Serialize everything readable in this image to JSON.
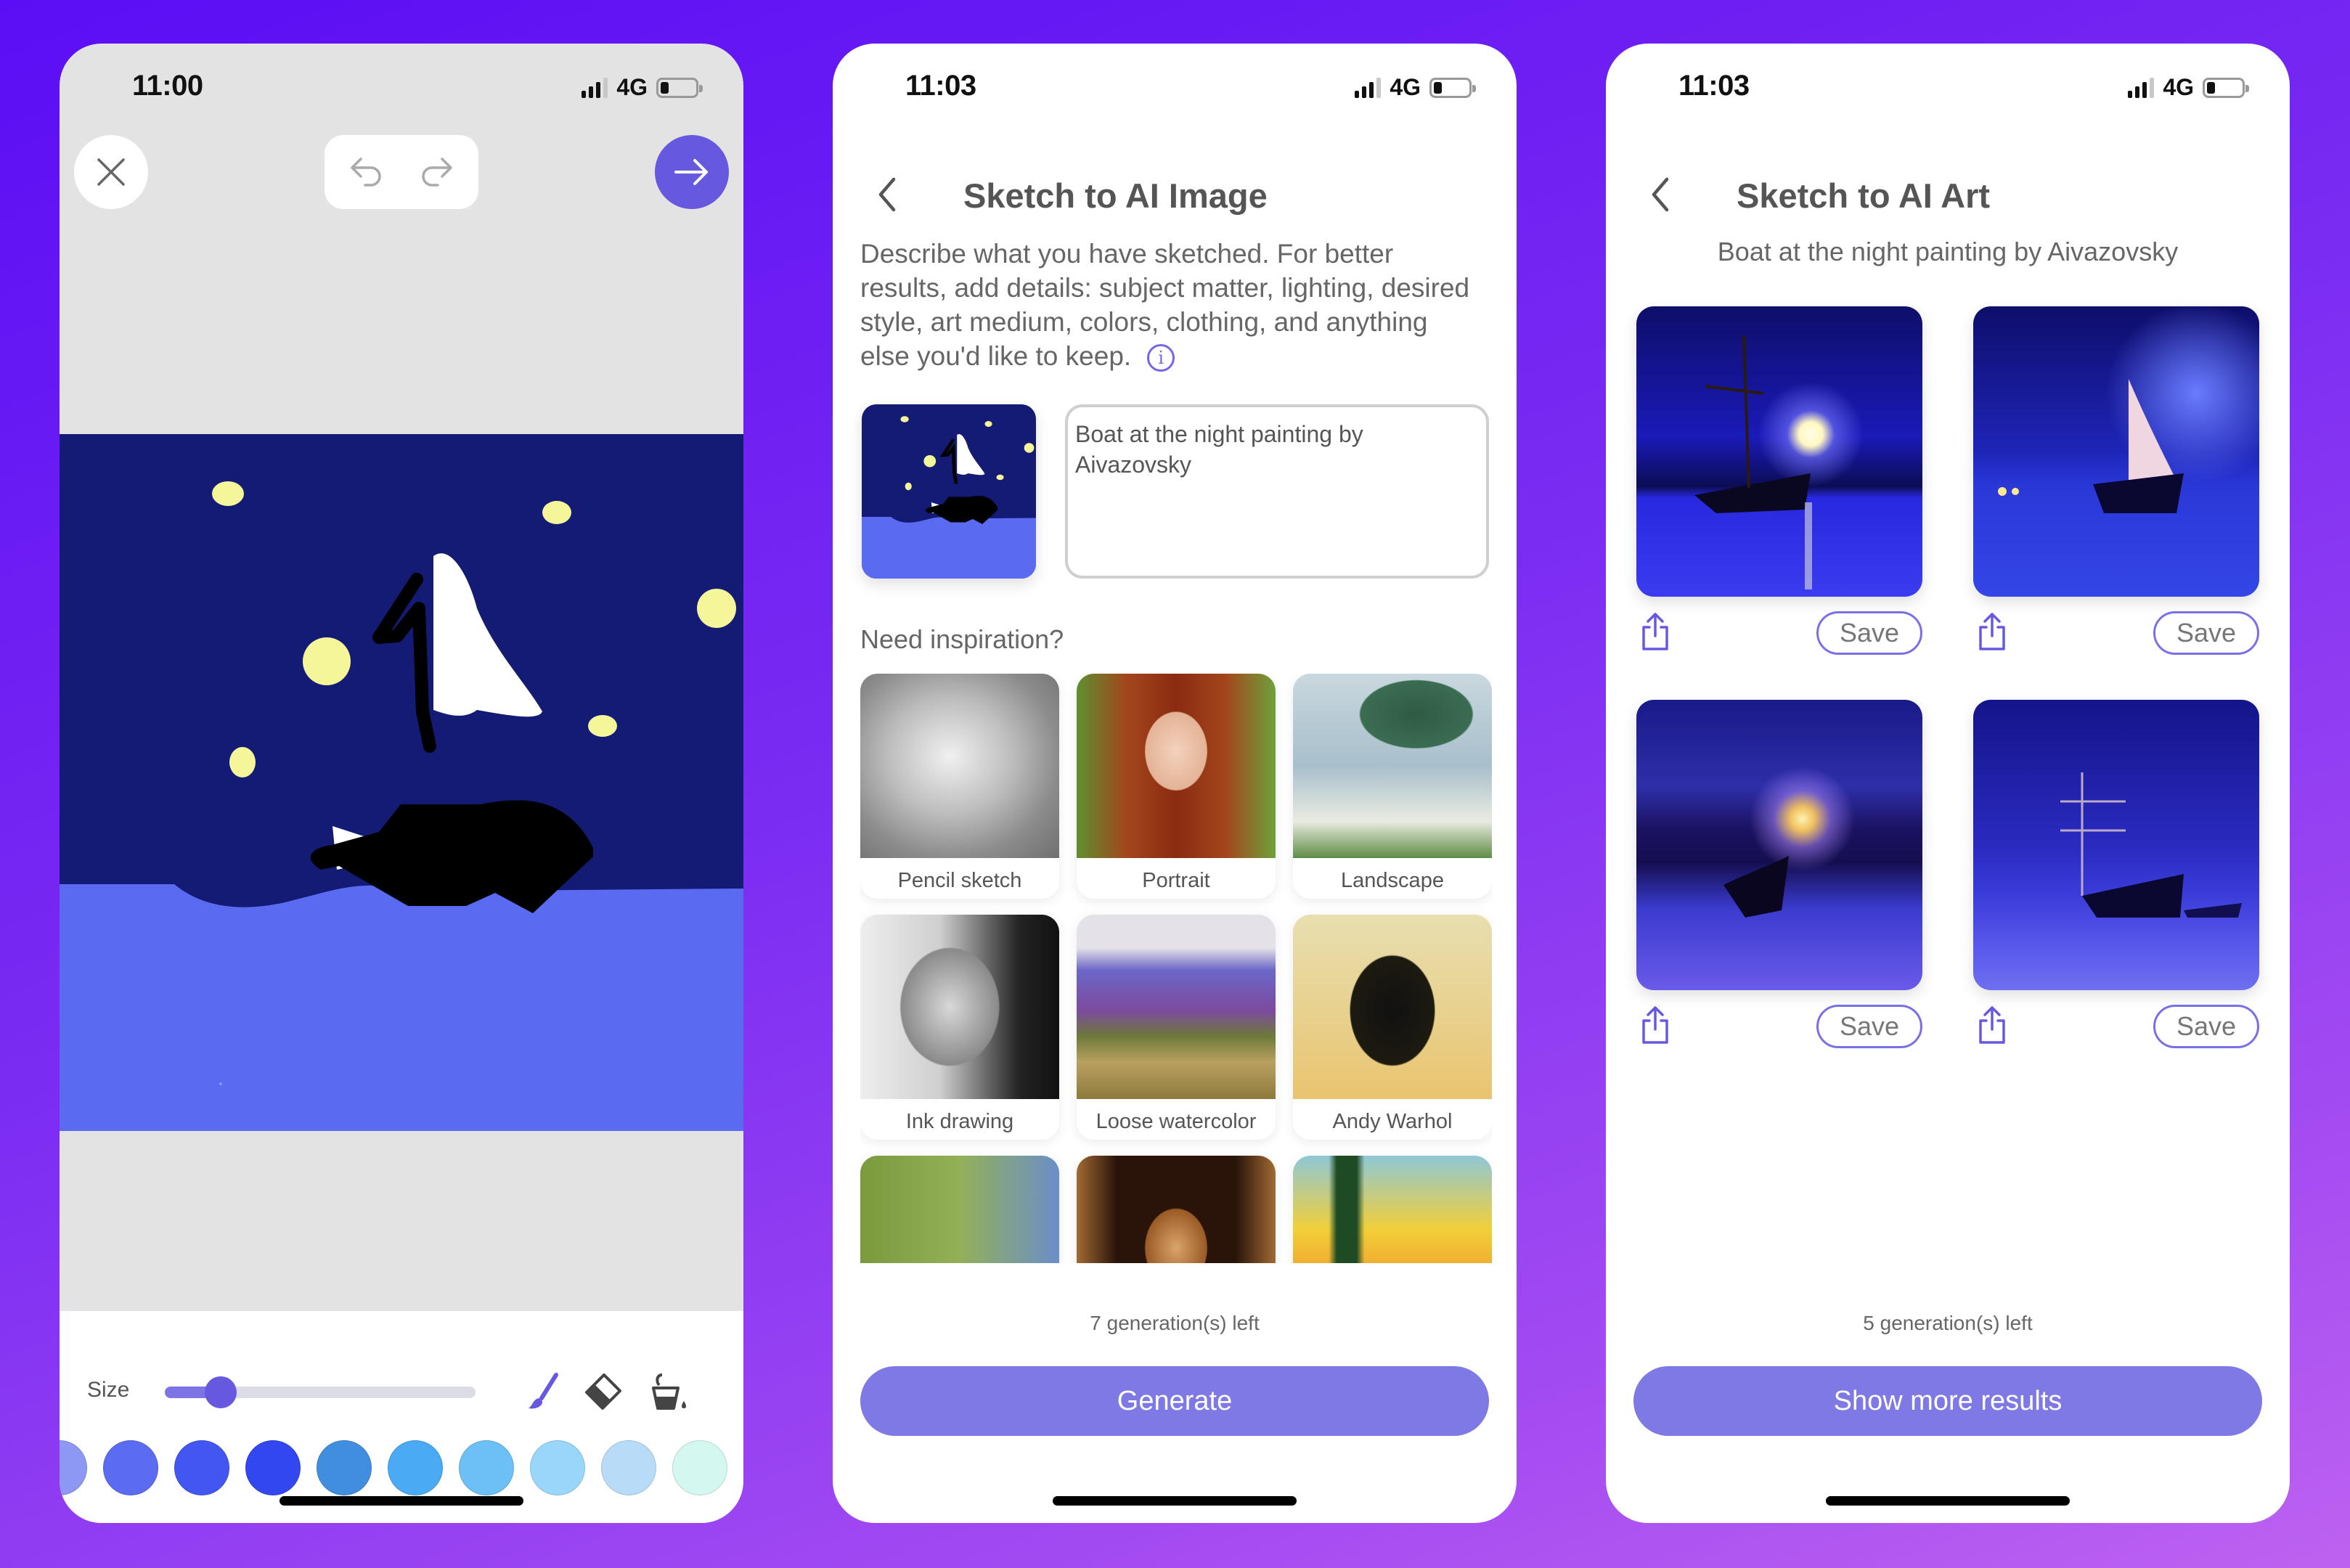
{
  "screens": [
    {
      "status": {
        "time": "11:00",
        "network": "4G"
      },
      "toolbar": {
        "size_label": "Size",
        "brush_size": 0.18,
        "tools": [
          "brush-icon",
          "eraser-icon",
          "fill-bucket-icon"
        ],
        "active_tool": "brush-icon"
      },
      "palette": [
        "#8d98f5",
        "#5b6cf2",
        "#4257f2",
        "#3347f0",
        "#418ee0",
        "#4aaaf4",
        "#6cc0f6",
        "#99d6fa",
        "#b8dcf8",
        "#d4f7ef"
      ],
      "icons": {
        "close": "close-icon",
        "undo": "undo-icon",
        "redo": "redo-icon",
        "next": "arrow-right-icon"
      }
    },
    {
      "status": {
        "time": "11:03",
        "network": "4G"
      },
      "title": "Sketch to AI Image",
      "description": "Describe what you have sketched. For better results, add details: subject matter, lighting, desired style, art medium, colors, clothing, and anything else you'd like to keep.",
      "prompt": "Boat at the night painting by Aivazovsky",
      "inspiration_label": "Need inspiration?",
      "styles": [
        {
          "label": "Pencil sketch"
        },
        {
          "label": "Portrait"
        },
        {
          "label": "Landscape"
        },
        {
          "label": "Ink drawing"
        },
        {
          "label": "Loose watercolor"
        },
        {
          "label": "Andy Warhol"
        },
        {
          "label": ""
        },
        {
          "label": ""
        },
        {
          "label": ""
        }
      ],
      "generations_left": "7 generation(s) left",
      "generate_label": "Generate"
    },
    {
      "status": {
        "time": "11:03",
        "network": "4G"
      },
      "title": "Sketch to AI Art",
      "prompt_caption": "Boat at the night painting by Aivazovsky",
      "results": [
        {
          "save_label": "Save"
        },
        {
          "save_label": "Save"
        },
        {
          "save_label": "Save"
        },
        {
          "save_label": "Save"
        }
      ],
      "generations_left": "5 generation(s) left",
      "more_label": "Show more results"
    }
  ],
  "colors": {
    "accent": "#6659e0",
    "button": "#7e79e4",
    "sky": "#141b74",
    "sea": "#5a6bf2",
    "star": "#f5f59a"
  }
}
